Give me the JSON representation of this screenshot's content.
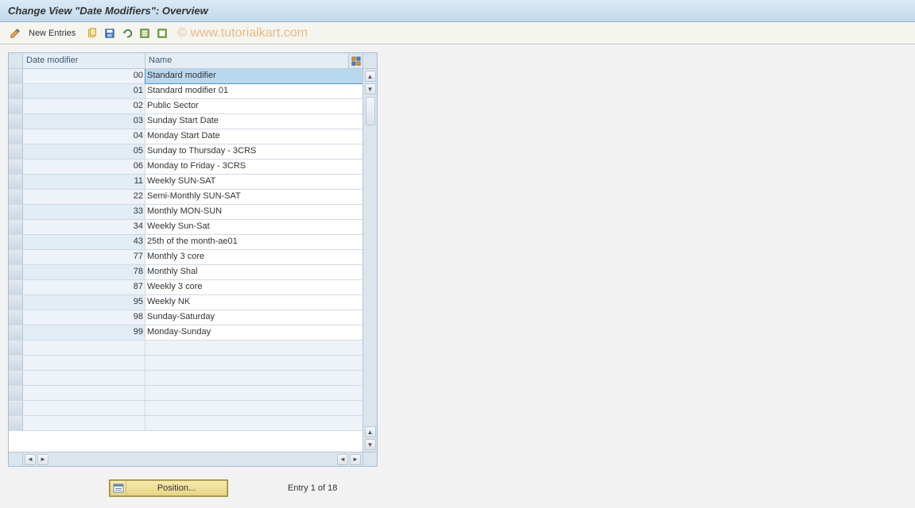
{
  "title": "Change View \"Date Modifiers\": Overview",
  "toolbar": {
    "new_entries": "New Entries"
  },
  "watermark": "© www.tutorialkart.com",
  "table": {
    "header_code": "Date modifier",
    "header_name": "Name",
    "rows": [
      {
        "code": "00",
        "name": "Standard modifier",
        "selected": true
      },
      {
        "code": "01",
        "name": "Standard modifier 01"
      },
      {
        "code": "02",
        "name": "Public Sector"
      },
      {
        "code": "03",
        "name": "Sunday Start Date"
      },
      {
        "code": "04",
        "name": "Monday Start Date"
      },
      {
        "code": "05",
        "name": "Sunday to Thursday - 3CRS"
      },
      {
        "code": "06",
        "name": "Monday to Friday - 3CRS"
      },
      {
        "code": "11",
        "name": "Weekly SUN-SAT"
      },
      {
        "code": "22",
        "name": "Semi-Monthly SUN-SAT"
      },
      {
        "code": "33",
        "name": "Monthly MON-SUN"
      },
      {
        "code": "34",
        "name": "Weekly Sun-Sat"
      },
      {
        "code": "43",
        "name": "25th of the month-ae01"
      },
      {
        "code": "77",
        "name": "Monthly 3 core"
      },
      {
        "code": "78",
        "name": "Monthly Shal"
      },
      {
        "code": "87",
        "name": "Weekly 3 core"
      },
      {
        "code": "95",
        "name": "Weekly NK"
      },
      {
        "code": "98",
        "name": "Sunday-Saturday"
      },
      {
        "code": "99",
        "name": "Monday-Sunday"
      }
    ],
    "empty_rows": 6
  },
  "footer": {
    "position_label": "Position...",
    "entry_count": "Entry 1 of 18"
  }
}
